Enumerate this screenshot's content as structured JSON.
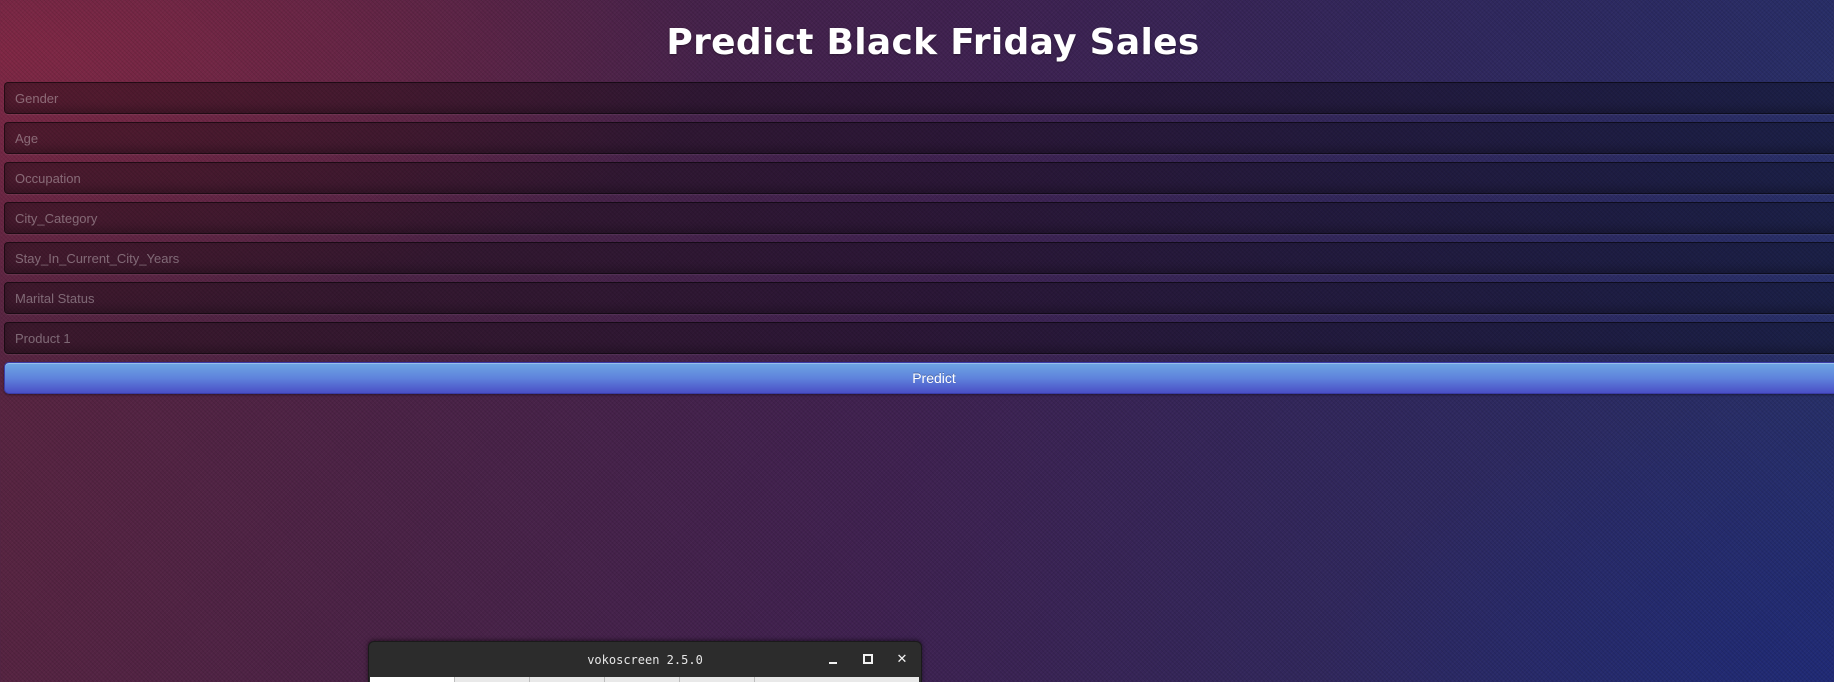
{
  "page": {
    "title": "Predict Black Friday Sales"
  },
  "form": {
    "fields": [
      {
        "name": "gender-field",
        "placeholder": "Gender",
        "value": ""
      },
      {
        "name": "age-field",
        "placeholder": "Age",
        "value": ""
      },
      {
        "name": "occupation-field",
        "placeholder": "Occupation",
        "value": ""
      },
      {
        "name": "city-category-field",
        "placeholder": "City_Category",
        "value": ""
      },
      {
        "name": "stay-years-field",
        "placeholder": "Stay_In_Current_City_Years",
        "value": ""
      },
      {
        "name": "marital-status-field",
        "placeholder": "Marital Status",
        "value": ""
      },
      {
        "name": "product-1-field",
        "placeholder": "Product 1",
        "value": ""
      }
    ],
    "submit_label": "Predict"
  },
  "taskbar_window": {
    "title": "vokoscreen 2.5.0",
    "buttons": {
      "minimize": "minimize-icon",
      "maximize": "maximize-icon",
      "close": "close-icon",
      "close_glyph": "✕"
    }
  },
  "colors": {
    "button_top": "#6ea5e3",
    "button_bottom": "#4a4fc6",
    "title_text": "#ffffff",
    "background_left": "#5a2440",
    "background_right": "#26306a"
  }
}
